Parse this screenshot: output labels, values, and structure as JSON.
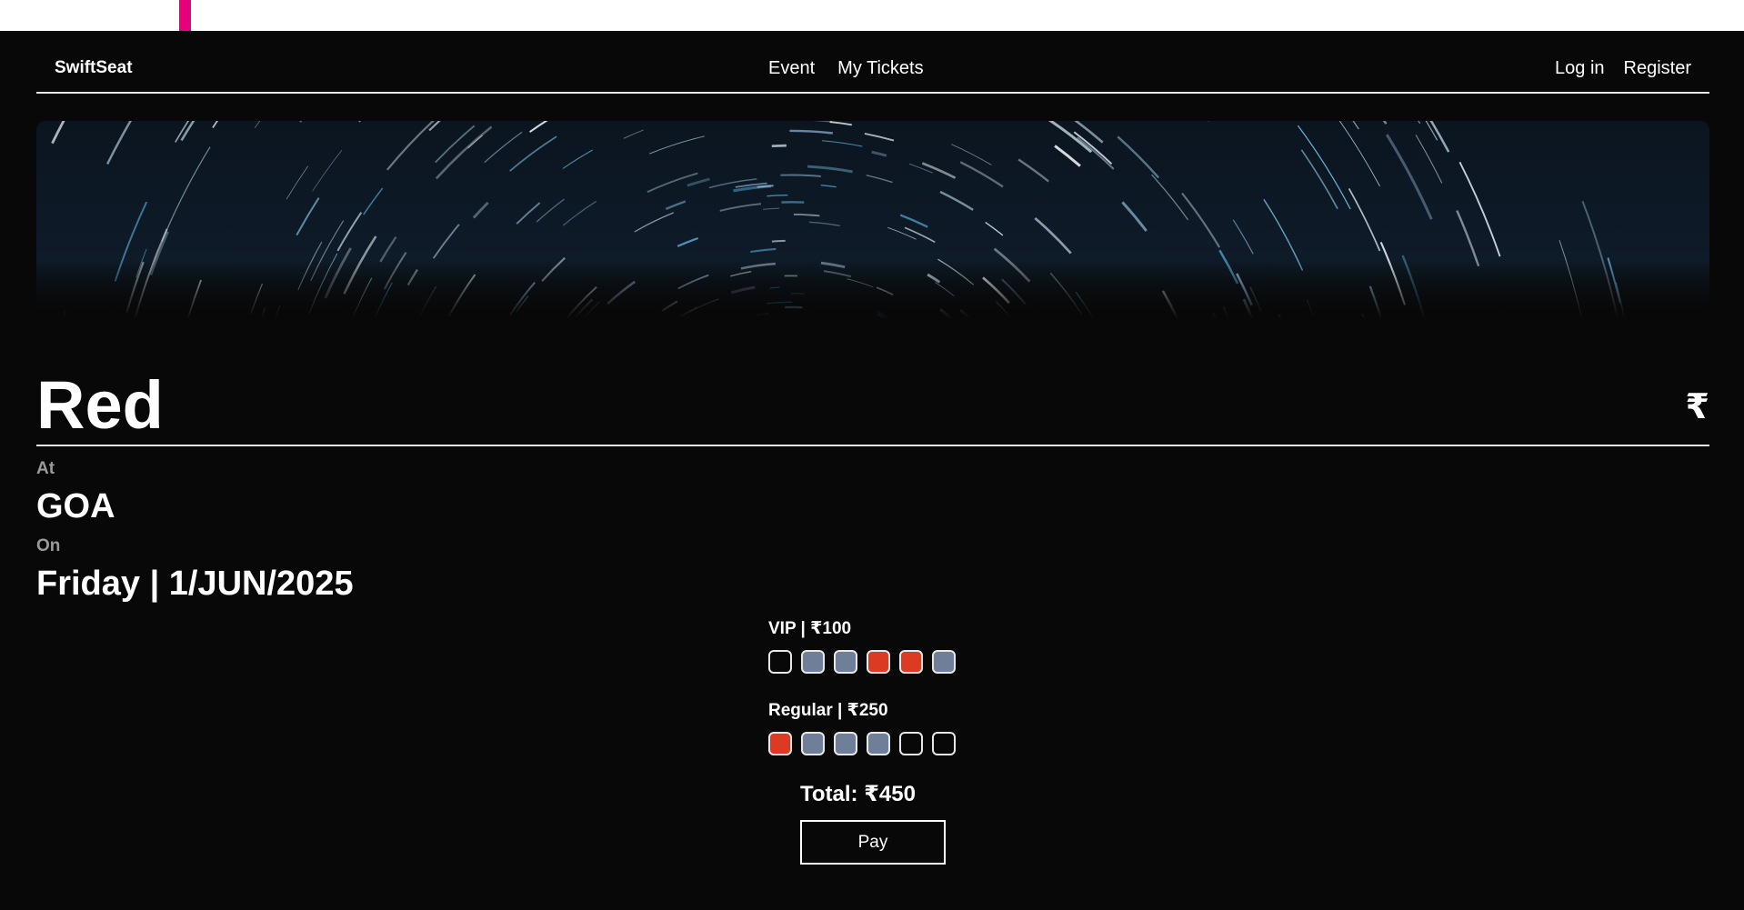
{
  "nav": {
    "brand": "SwiftSeat",
    "links": [
      "Event",
      "My Tickets"
    ],
    "auth": [
      "Log in",
      "Register"
    ]
  },
  "event": {
    "name": "Red",
    "currency_symbol": "₹",
    "at_label": "At",
    "venue": "GOA",
    "on_label": "On",
    "date": "Friday | 1/JUN/2025"
  },
  "seating": {
    "legend": {
      "available": "#080808",
      "selected": "#6f7f9a",
      "booked": "#dd3a24"
    },
    "sections": [
      {
        "label": "VIP | ₹100",
        "seats": [
          "available",
          "selected",
          "selected",
          "booked",
          "booked",
          "selected"
        ]
      },
      {
        "label": "Regular | ₹250",
        "seats": [
          "booked",
          "selected",
          "selected",
          "selected",
          "available",
          "available"
        ]
      }
    ]
  },
  "checkout": {
    "total": "Total: ₹450",
    "pay_label": "Pay"
  },
  "colors": {
    "background": "#080808",
    "accent_marker": "#e6007e"
  }
}
